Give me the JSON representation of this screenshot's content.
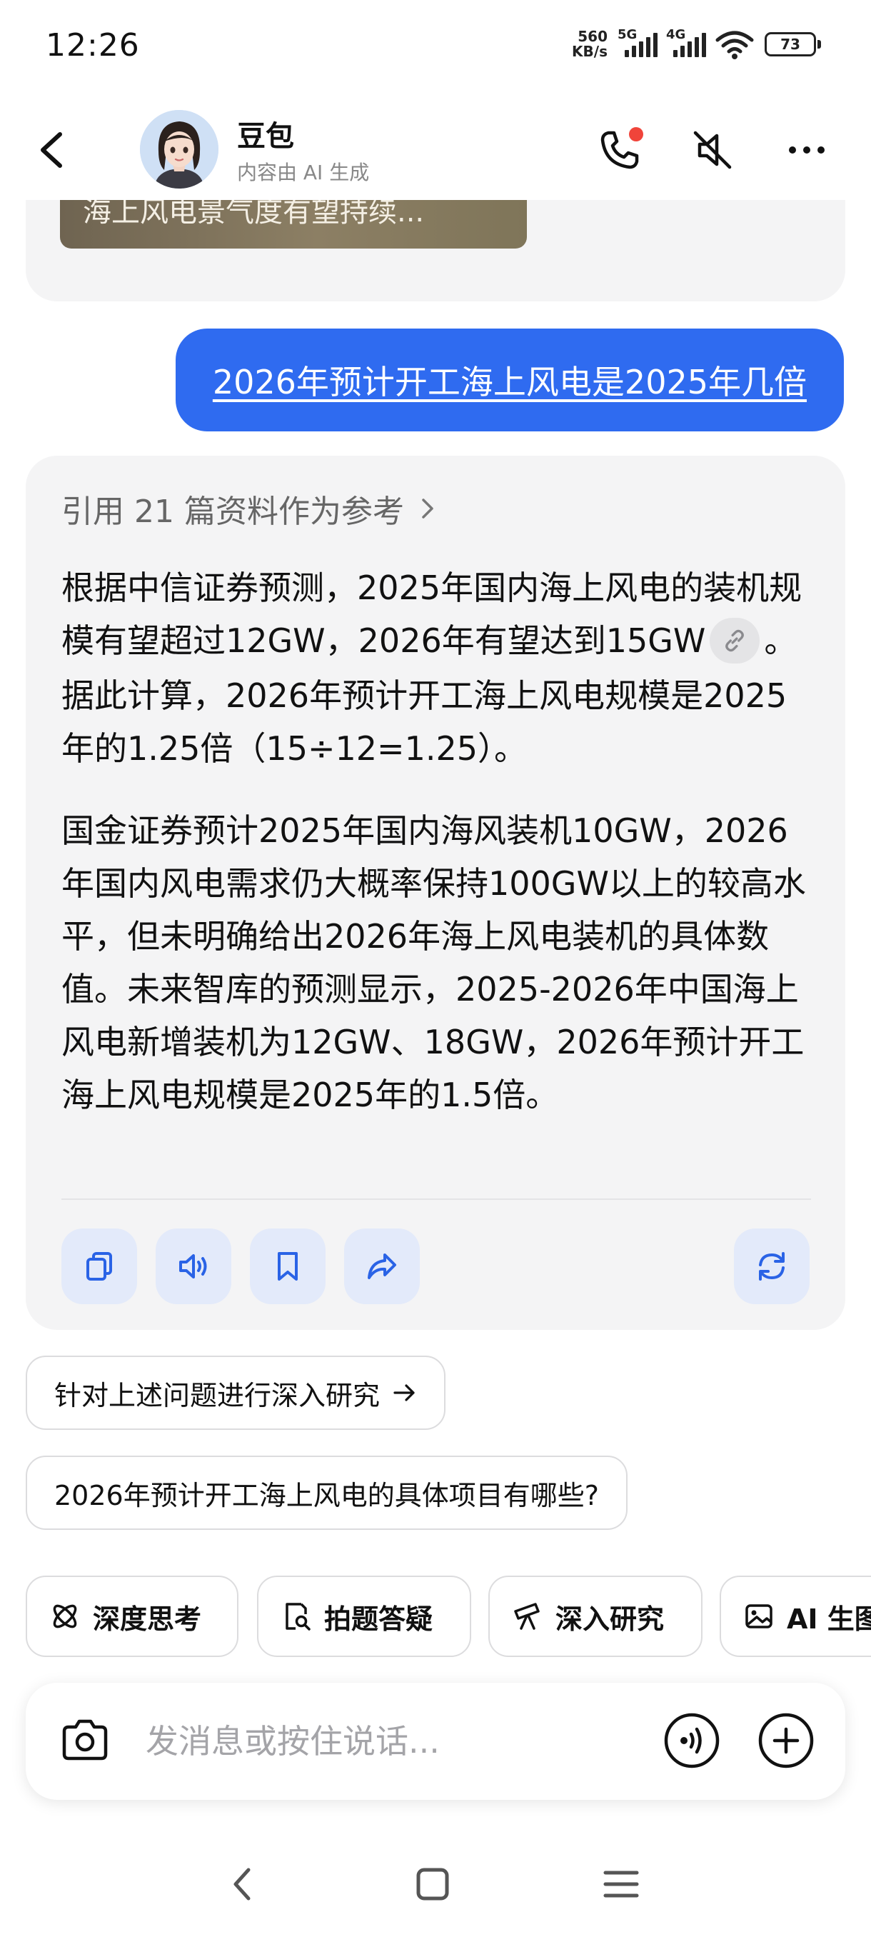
{
  "status_bar": {
    "time": "12:26",
    "net_speed_value": "560",
    "net_speed_unit": "KB/s",
    "signal1_label": "5G",
    "signal2_label": "4G",
    "battery": "73"
  },
  "header": {
    "bot_name": "豆包",
    "subtitle": "内容由 AI 生成",
    "call_badge_color": "#f0443a"
  },
  "previous_card": {
    "title_snippet": "海上风电景气度有望持续..."
  },
  "user_message": "2026年预计开工海上风电是2025年几倍",
  "answer": {
    "references_label": "引用 21 篇资料作为参考",
    "para1_before_link": "根据中信证券预测，2025年国内海上风电的装机规模有望超过12GW，2026年有望达到15GW",
    "para1_after_link": "。据此计算，2026年预计开工海上风电规模是2025年的1.25倍（15÷12=1.25）。",
    "para2": "国金证券预计2025年国内海风装机10GW，2026年国内风电需求仍大概率保持100GW以上的较高水平，但未明确给出2026年海上风电装机的具体数值。未来智库的预测显示，2025-2026年中国海上风电新增装机为12GW、18GW，2026年预计开工海上风电规模是2025年的1.5倍。",
    "actions": {
      "copy_icon": "copy-icon",
      "speak_icon": "speaker-icon",
      "bookmark_icon": "bookmark-icon",
      "share_icon": "share-icon",
      "regenerate_icon": "refresh-icon"
    }
  },
  "suggestions": [
    "针对上述问题进行深入研究",
    "2026年预计开工海上风电的具体项目有哪些?"
  ],
  "chips": [
    "深度思考",
    "拍题答疑",
    "深入研究",
    "AI 生图"
  ],
  "input": {
    "placeholder": "发消息或按住说话..."
  },
  "colors": {
    "accent": "#2f6bf0",
    "icon_blue": "#2a63e6",
    "card_bg": "#f4f4f5",
    "action_bg": "#e3eafa"
  }
}
